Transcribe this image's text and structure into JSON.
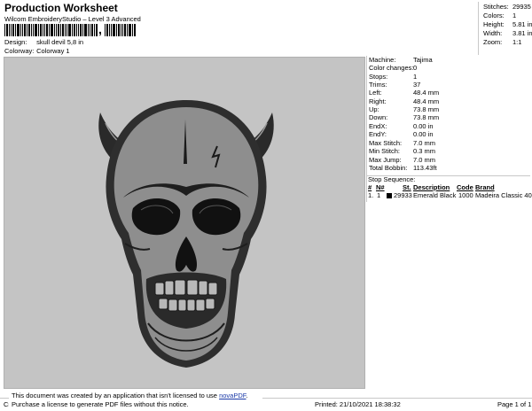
{
  "header": {
    "title": "Production Worksheet",
    "subtitle": "Wilcom EmbroideryStudio – Level 3 Advanced",
    "barcode_separator": ","
  },
  "design_info": {
    "design_label": "Design:",
    "design_value": "skull devil 5,8 in",
    "colorway_label": "Colorway:",
    "colorway_value": "Colorway 1"
  },
  "stats": [
    {
      "label": "Stitches:",
      "value": "29935"
    },
    {
      "label": "Colors:",
      "value": "1"
    },
    {
      "label": "Height:",
      "value": "5.81 in"
    },
    {
      "label": "Width:",
      "value": "3.81 in"
    },
    {
      "label": "Zoom:",
      "value": "1:1"
    }
  ],
  "machine_info": [
    {
      "label": "Machine:",
      "value": "Tajima"
    },
    {
      "label": "Color changes:",
      "value": "0"
    },
    {
      "label": "Stops:",
      "value": "1"
    },
    {
      "label": "Trims:",
      "value": "37"
    },
    {
      "label": "Left:",
      "value": "48.4 mm"
    },
    {
      "label": "Right:",
      "value": "48.4 mm"
    },
    {
      "label": "Up:",
      "value": "73.8 mm"
    },
    {
      "label": "Down:",
      "value": "73.8 mm"
    },
    {
      "label": "EndX:",
      "value": "0.00 in"
    },
    {
      "label": "EndY:",
      "value": "0.00 in"
    },
    {
      "label": "Max Stitch:",
      "value": "7.0 mm"
    },
    {
      "label": "Min Stitch:",
      "value": "0.3 mm"
    },
    {
      "label": "Max Jump:",
      "value": "7.0 mm"
    },
    {
      "label": "Total Bobbin:",
      "value": "113.43ft"
    }
  ],
  "stop_sequence": {
    "heading": "Stop Sequence:",
    "columns": [
      "#",
      "N#",
      "St.",
      "Description",
      "Code",
      "Brand"
    ],
    "rows": [
      {
        "num": "1.",
        "n": "1",
        "stitches": "29933",
        "description": "Emerald Black",
        "code": "1000",
        "brand": "Madeira Classic 40",
        "color": "#000000"
      }
    ]
  },
  "footer": {
    "left_text": "Cr",
    "notice_line1": "This document was created by an application that isn't licensed to use",
    "notice_link": "novaPDF",
    "notice_line1_end": ".",
    "notice_line2": "Purchase a license to generate PDF files without this notice.",
    "printed": "Printed: 21/10/2021 18:38:32",
    "page": "Page 1 of 1"
  },
  "colors": {
    "design_background": "#c4c4c4",
    "thread": "#000000",
    "link": "#1b3aa8"
  }
}
